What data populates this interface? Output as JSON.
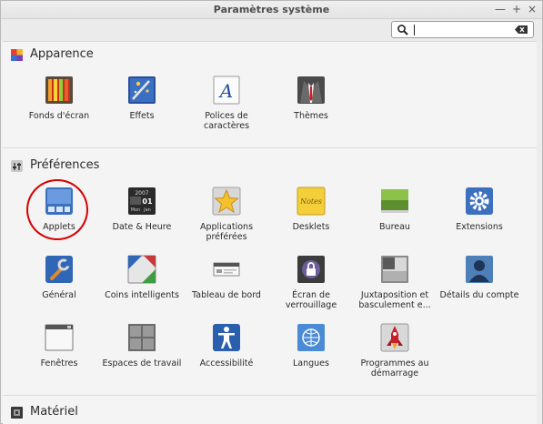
{
  "window": {
    "title": "Paramètres système",
    "controls": [
      "minimize-icon",
      "maximize-icon",
      "close-icon"
    ],
    "controls_glyphs": [
      "—",
      "+",
      "×"
    ]
  },
  "search": {
    "value": "",
    "icon": "search-icon",
    "clear_icon": "clear-text-icon"
  },
  "sections": [
    {
      "title": "Apparence",
      "icon": "appearance-icon",
      "items": [
        {
          "label": "Fonds d'écran",
          "icon": "wallpaper-icon"
        },
        {
          "label": "Effets",
          "icon": "effects-icon"
        },
        {
          "label": "Polices de caractères",
          "icon": "fonts-icon"
        },
        {
          "label": "Thèmes",
          "icon": "themes-icon"
        }
      ]
    },
    {
      "title": "Préférences",
      "icon": "preferences-icon",
      "items": [
        {
          "label": "Applets",
          "icon": "applets-icon"
        },
        {
          "label": "Date & Heure",
          "icon": "date-time-icon"
        },
        {
          "label": "Applications préférées",
          "icon": "preferred-apps-icon"
        },
        {
          "label": "Desklets",
          "icon": "desklets-icon"
        },
        {
          "label": "Bureau",
          "icon": "desktop-icon"
        },
        {
          "label": "Extensions",
          "icon": "extensions-icon"
        },
        {
          "label": "Général",
          "icon": "general-icon"
        },
        {
          "label": "Coins intelligents",
          "icon": "hot-corners-icon"
        },
        {
          "label": "Tableau de bord",
          "icon": "panel-icon"
        },
        {
          "label": "Écran de verrouillage",
          "icon": "lock-screen-icon"
        },
        {
          "label": "Juxtaposition et basculement e...",
          "icon": "tiling-icon"
        },
        {
          "label": "Détails du compte",
          "icon": "account-icon"
        },
        {
          "label": "Fenêtres",
          "icon": "windows-icon"
        },
        {
          "label": "Espaces de travail",
          "icon": "workspaces-icon"
        },
        {
          "label": "Accessibilité",
          "icon": "accessibility-icon"
        },
        {
          "label": "Langues",
          "icon": "languages-icon"
        },
        {
          "label": "Programmes au démarrage",
          "icon": "startup-programs-icon"
        }
      ]
    },
    {
      "title": "Matériel",
      "icon": "hardware-icon",
      "items": []
    }
  ],
  "date_icon": {
    "year": "2007",
    "day": "01",
    "month": "Jan",
    "weekday": "Mon"
  },
  "desklet_icon_text": "Notes",
  "colors": {
    "highlight_ring": "#d60000"
  }
}
